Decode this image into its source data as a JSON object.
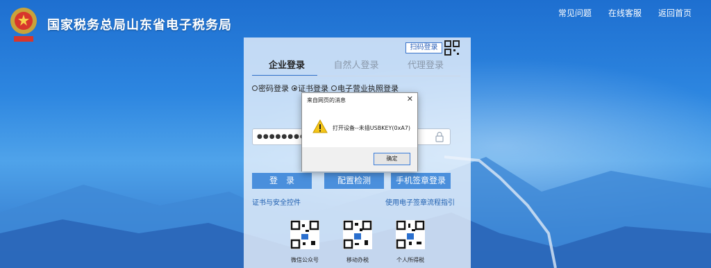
{
  "header": {
    "site_title": "国家税务总局山东省电子税务局",
    "nav": [
      "常见问题",
      "在线客服",
      "返回首页"
    ]
  },
  "login": {
    "qr_login_label": "扫码登录",
    "tabs": [
      "企业登录",
      "自然人登录",
      "代理登录"
    ],
    "active_tab": 0,
    "radios": [
      "密码登录",
      "证书登录",
      "电子营业执照登录"
    ],
    "selected_radio": 1,
    "password_masked": "●●●●●●●●●",
    "buttons": {
      "login": "登　录",
      "check": "配置检测",
      "phone": "手机签章登录"
    },
    "links": {
      "cert": "证书与安全控件",
      "guide": "使用电子签章流程指引"
    },
    "qr_codes": [
      "微信公众号",
      "移动办税",
      "个人所得税"
    ]
  },
  "dialog": {
    "title": "来自网页的消息",
    "message": "打开设备--未插USBKEY(0xA7)",
    "ok_label": "确定"
  },
  "colors": {
    "accent": "#2a6fce",
    "button": "#4a8fdc",
    "link": "#1f5fb0"
  }
}
